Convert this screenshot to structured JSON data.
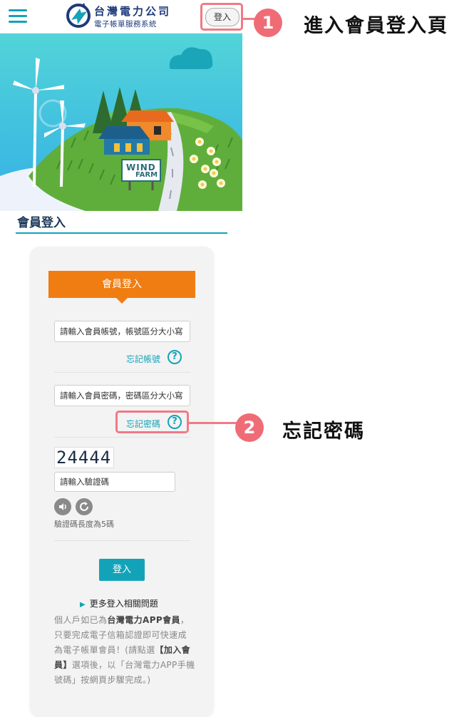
{
  "header": {
    "logo_title": "台灣電力公司",
    "logo_sub": "電子帳單服務系統",
    "login_label": "登入"
  },
  "annotations": {
    "step1_num": "1",
    "step1_text": "進入會員登入頁",
    "step2_num": "2",
    "step2_text": "忘記密碼"
  },
  "banner": {
    "sign_line1": "WIND",
    "sign_line2": "FARM"
  },
  "section": {
    "title": "會員登入"
  },
  "form": {
    "heading": "會員登入",
    "account_placeholder": "請輸入會員帳號，帳號區分大小寫",
    "forgot_account": "忘記帳號",
    "password_placeholder": "請輸入會員密碼，密碼區分大小寫",
    "forgot_password": "忘記密碼",
    "help_glyph": "?",
    "captcha_text": "24444",
    "captcha_placeholder": "請輸入驗證碼",
    "captcha_hint": "驗證碼長度為5碼",
    "submit_label": "登入",
    "more_help": "更多登入相關問題",
    "desc_1": "個人戶如已為",
    "desc_2": "台灣電力APP會員",
    "desc_3": "，只要完成電子信箱認證即可快速成為電子帳單會員！(請點選",
    "desc_4": "【加入會員】",
    "desc_5": "選項後，以「台灣電力APP手機號碼」按網頁步驟完成。)"
  },
  "colors": {
    "accent": "#13a3b8",
    "orange": "#f07d12",
    "annotation": "#ef6c77",
    "navy": "#1d3a7b"
  },
  "icons": {
    "menu": "hamburger-icon",
    "audio": "speaker-icon",
    "refresh": "refresh-icon",
    "help": "question-mark-icon"
  }
}
